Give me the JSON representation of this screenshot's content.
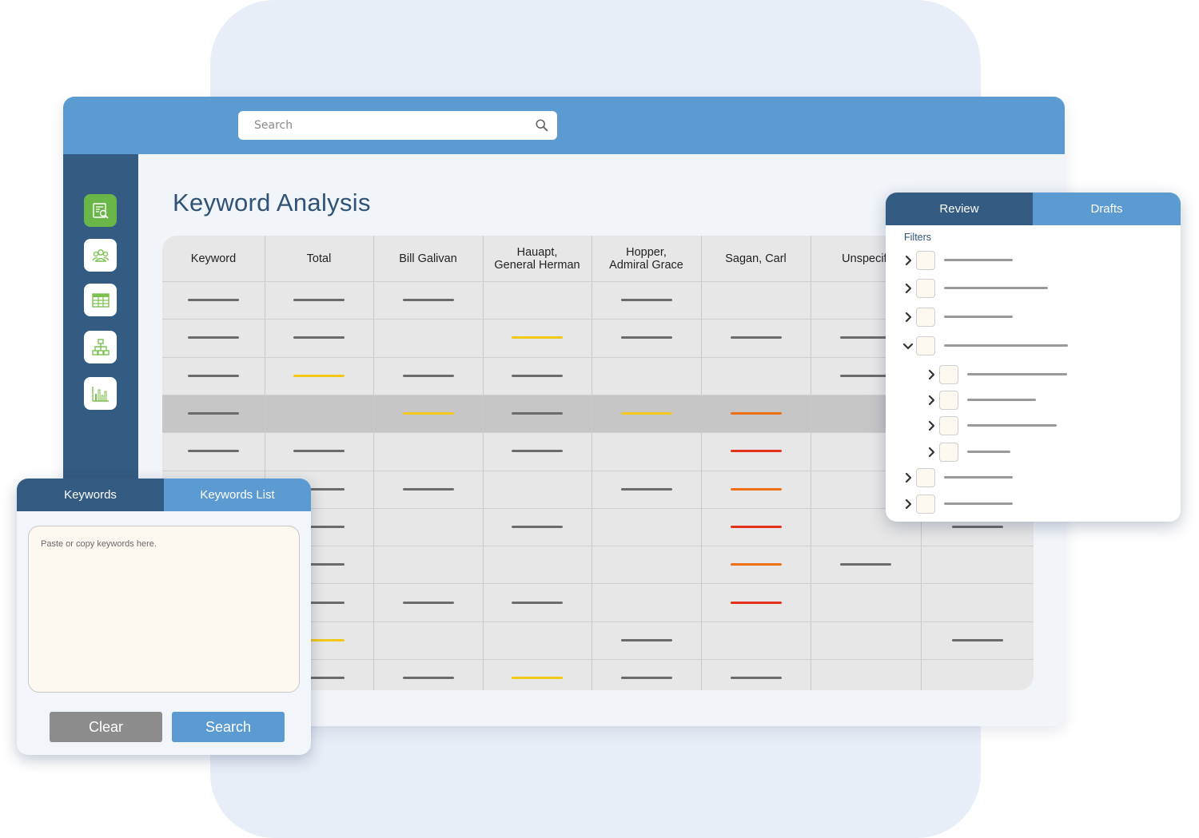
{
  "search": {
    "placeholder": "Search"
  },
  "sidebar": {
    "items": [
      {
        "icon": "document-search-icon",
        "active": true
      },
      {
        "icon": "users-icon",
        "active": false
      },
      {
        "icon": "table-icon",
        "active": false
      },
      {
        "icon": "hierarchy-icon",
        "active": false
      },
      {
        "icon": "bar-chart-icon",
        "active": false
      }
    ]
  },
  "page": {
    "title": "Keyword Analysis"
  },
  "table": {
    "columns": [
      "Keyword",
      "Total",
      "Bill Galivan",
      "Hauapt,\nGeneral Herman",
      "Hopper,\nAdmiral Grace",
      "Sagan, Carl",
      "Unspecifi",
      ""
    ],
    "highlighted_row": 3,
    "rows": [
      [
        "g",
        "g",
        "g",
        "",
        "g",
        "",
        "",
        ""
      ],
      [
        "g",
        "g",
        "",
        "y",
        "g",
        "g",
        "g",
        ""
      ],
      [
        "g",
        "y",
        "g",
        "g",
        "",
        "",
        "g",
        ""
      ],
      [
        "g",
        "",
        "y",
        "g",
        "y",
        "o",
        "",
        ""
      ],
      [
        "g",
        "g",
        "",
        "g",
        "",
        "r",
        "",
        ""
      ],
      [
        "g",
        "g",
        "g",
        "",
        "g",
        "o",
        "",
        ""
      ],
      [
        "g",
        "g",
        "",
        "g",
        "",
        "r",
        "",
        "g"
      ],
      [
        "g",
        "g",
        "",
        "",
        "",
        "o",
        "g",
        ""
      ],
      [
        "g",
        "g",
        "g",
        "g",
        "",
        "r",
        "",
        ""
      ],
      [
        "g",
        "y",
        "",
        "",
        "g",
        "",
        "",
        "g"
      ],
      [
        "g",
        "g",
        "g",
        "y",
        "g",
        "g",
        "",
        ""
      ]
    ]
  },
  "colors": {
    "g": "#6b6b6b",
    "y": "#f2c81a",
    "o": "#ee6f16",
    "r": "#e5321c"
  },
  "keywords_panel": {
    "tabs": [
      "Keywords",
      "Keywords List"
    ],
    "placeholder": "Paste or copy keywords here.",
    "clear_label": "Clear",
    "search_label": "Search"
  },
  "review_panel": {
    "tabs": [
      "Review",
      "Drafts"
    ],
    "filters_label": "Filters",
    "tree": [
      {
        "level": 0,
        "expanded": false
      },
      {
        "level": 0,
        "expanded": false
      },
      {
        "level": 0,
        "expanded": false
      },
      {
        "level": 0,
        "expanded": true
      },
      {
        "level": 1,
        "expanded": false
      },
      {
        "level": 1,
        "expanded": false
      },
      {
        "level": 1,
        "expanded": false
      },
      {
        "level": 1,
        "expanded": false
      },
      {
        "level": 0,
        "expanded": false
      },
      {
        "level": 0,
        "expanded": false
      }
    ]
  }
}
